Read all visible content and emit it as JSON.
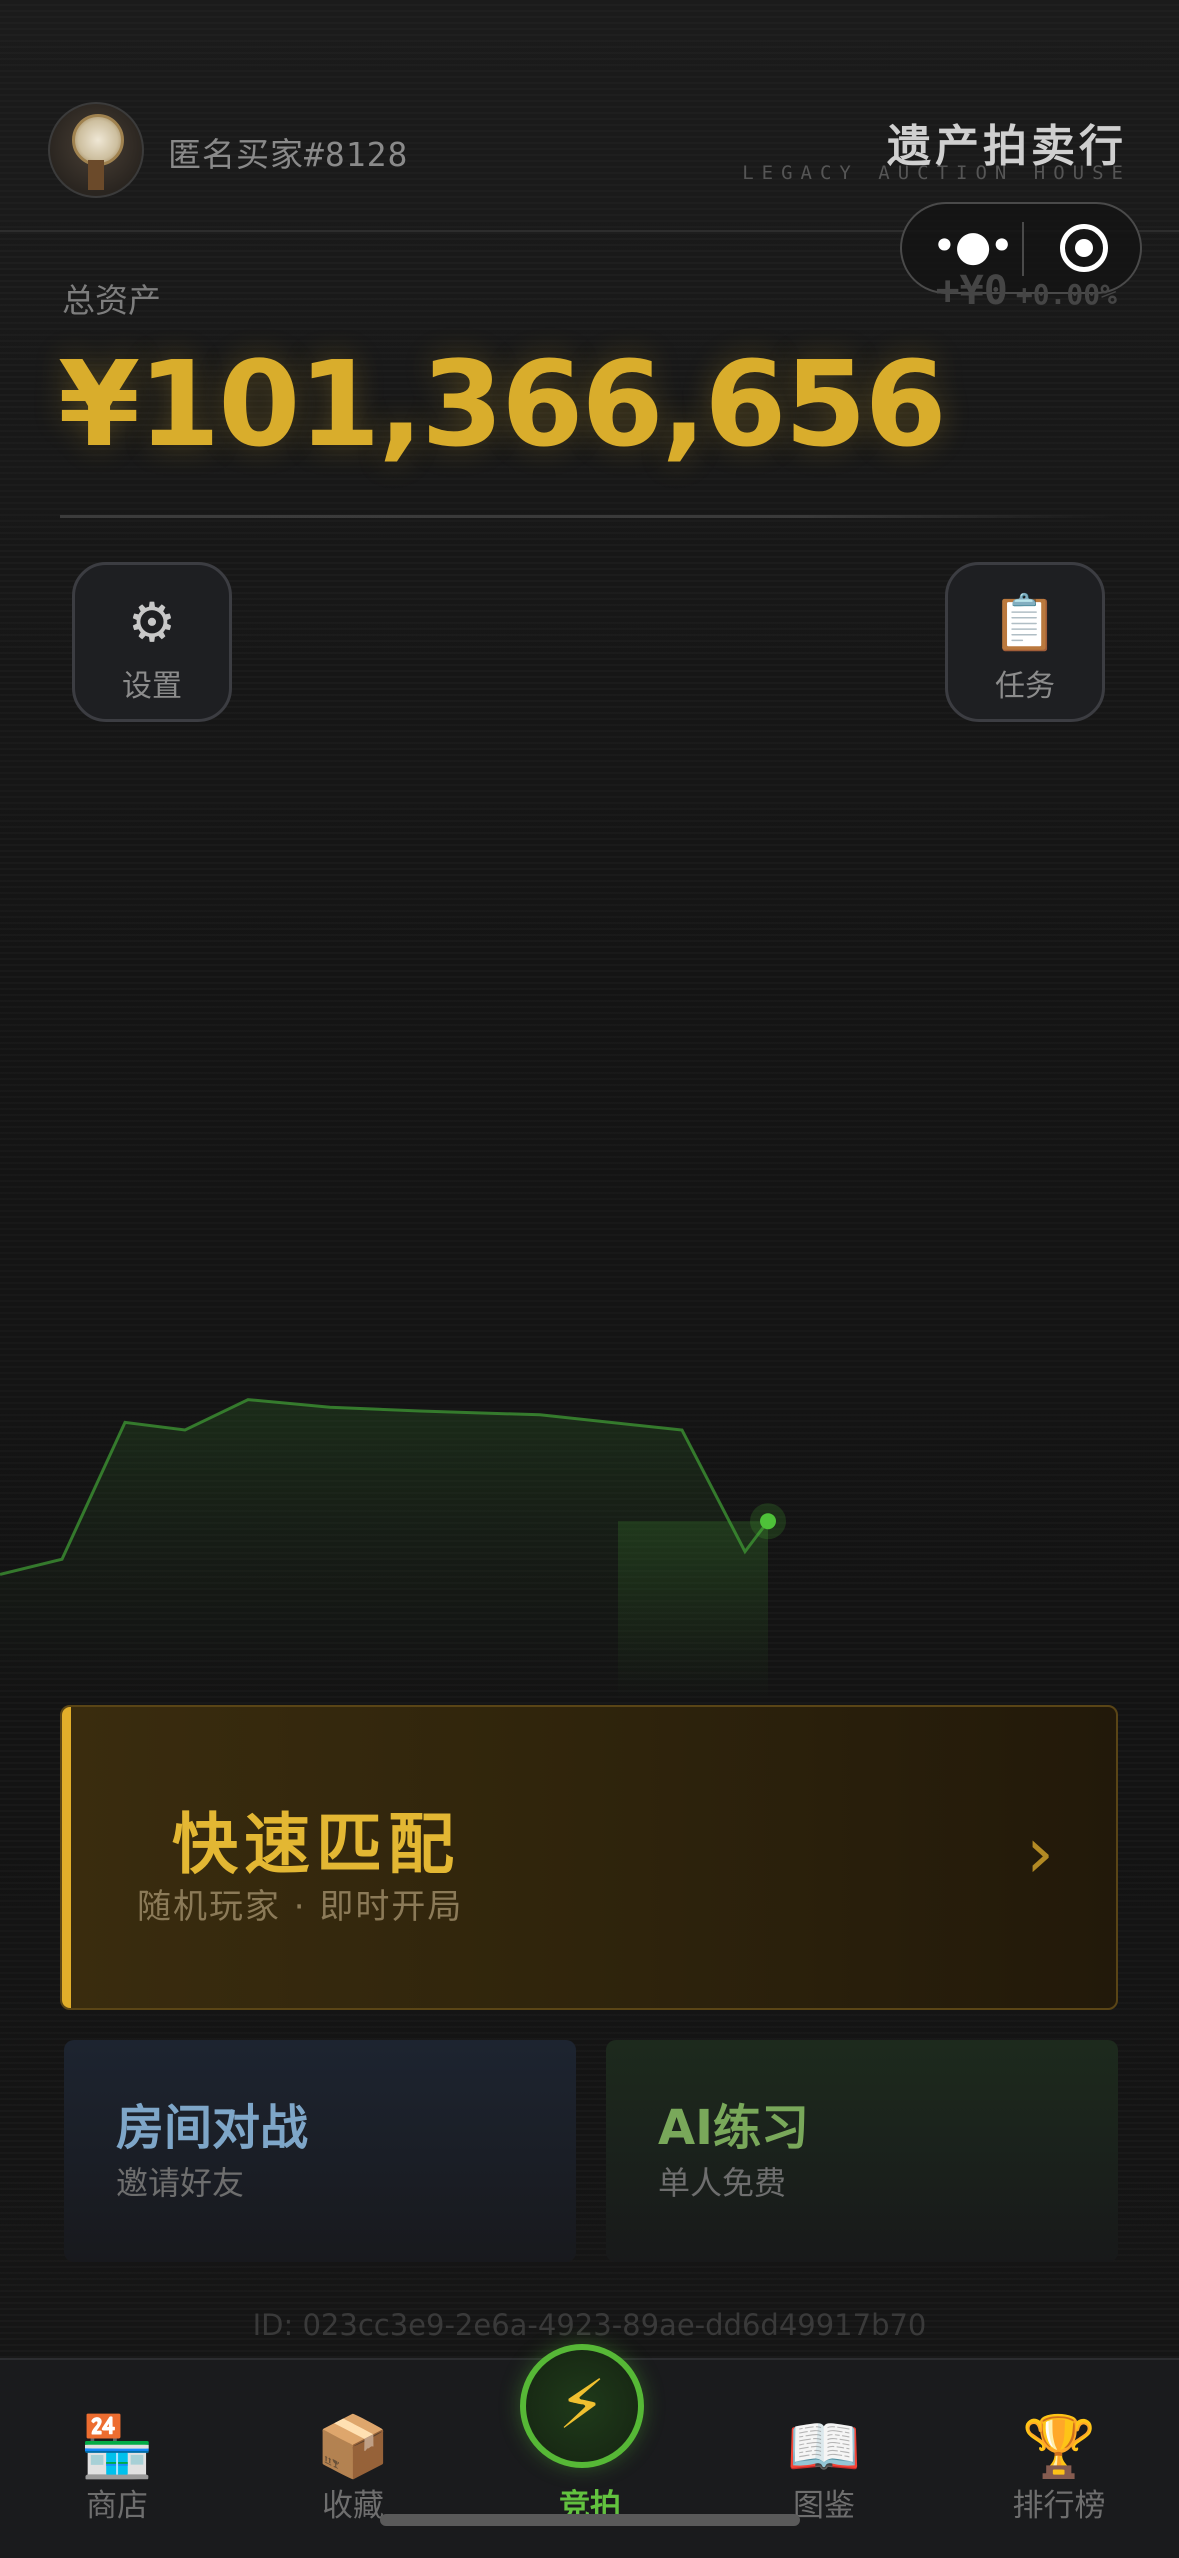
{
  "header": {
    "username": "匿名买家#8128",
    "brand_title": "遗产拍卖行",
    "brand_subtitle": "LEGACY AUCTION HOUSE"
  },
  "assets": {
    "label": "总资产",
    "value": "¥101,366,656",
    "delta": "+¥0",
    "delta_pct": "+0.00%"
  },
  "actions": {
    "settings_label": "设置",
    "tasks_label": "任务"
  },
  "chart_data": {
    "type": "line",
    "values": [
      0.12,
      0.16,
      0.52,
      0.5,
      0.58,
      0.56,
      0.55,
      0.54,
      0.5,
      0.18,
      0.26
    ],
    "color": "#3f9a34"
  },
  "quick_match": {
    "title": "快速匹配",
    "subtitle": "随机玩家 · 即时开局",
    "arrow": "›"
  },
  "modes": {
    "room": {
      "title": "房间对战",
      "subtitle": "邀请好友"
    },
    "ai": {
      "title": "AI练习",
      "subtitle": "单人免费"
    }
  },
  "footer_id": "ID: 023cc3e9-2e6a-4923-89ae-dd6d49917b70",
  "tabs": {
    "shop": "商店",
    "collection": "收藏",
    "bid": "竞拍",
    "guide": "图鉴",
    "ranking": "排行榜"
  },
  "colors": {
    "gold": "#d9ad2c",
    "green_active": "#56b836",
    "room_blue": "#7ea6c8",
    "ai_green": "#79a85a"
  }
}
